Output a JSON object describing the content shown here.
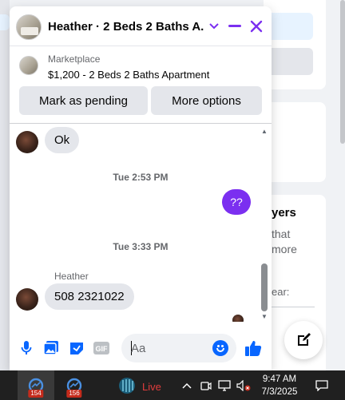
{
  "background": {
    "side_heading": "yers",
    "side_text": "that\nmore",
    "side_text2": "ear:"
  },
  "chat": {
    "title": "Heather · 2 Beds 2 Baths A...",
    "marketplace": {
      "label": "Marketplace",
      "listing": "$1,200 - 2 Beds 2 Baths Apartment"
    },
    "actions": {
      "pending": "Mark as pending",
      "more": "More options"
    },
    "messages": {
      "msg1": "Ok",
      "time1": "Tue 2:53 PM",
      "outgoing": "??",
      "time2": "Tue 3:33 PM",
      "sender": "Heather",
      "msg2": "508 2321022"
    },
    "composer": {
      "placeholder": "Aa",
      "gif": "GIF"
    }
  },
  "taskbar": {
    "badge1": "154",
    "badge2": "156",
    "live": "Live",
    "time": "9:47 AM",
    "date": "7/3/2025"
  },
  "colors": {
    "accent": "#7b2ff0",
    "messenger_blue": "#0866ff",
    "header_purple": "#7b2ff0"
  }
}
